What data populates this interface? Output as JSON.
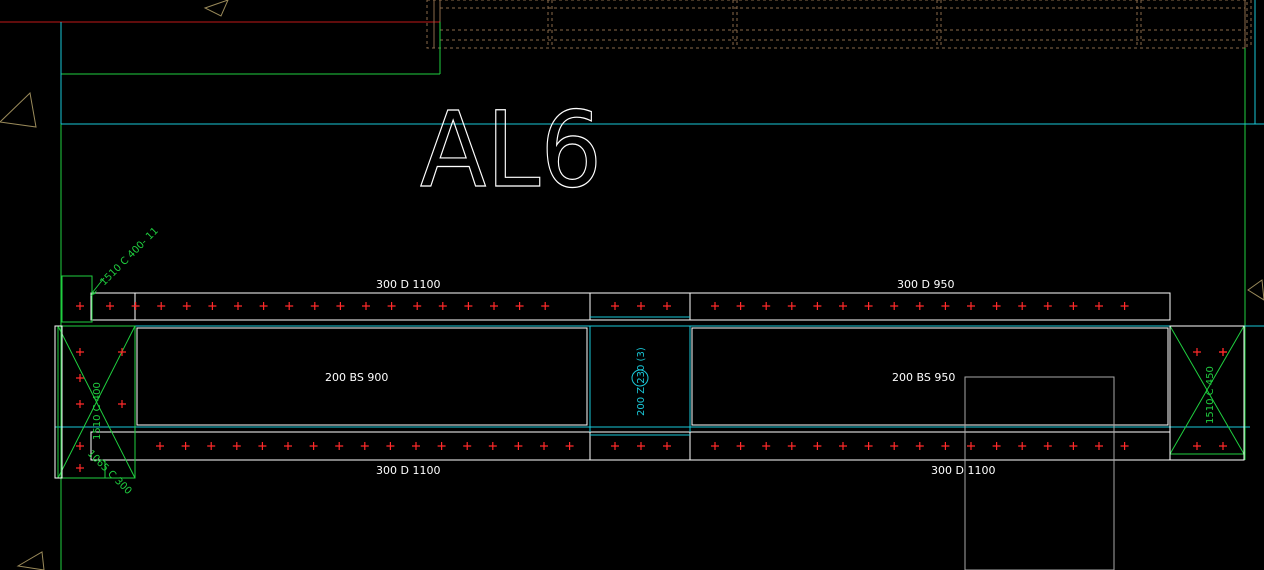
{
  "drawing": {
    "title": "AL6",
    "colors": {
      "background": "#000000",
      "outline": "#ffffff",
      "cyan": "#19c9d9",
      "green": "#1fcf3f",
      "rebar_mark": "#ff2a2a",
      "grid_red": "#c01818",
      "brown": "#8a6a4a",
      "gray": "#a8a8a8"
    },
    "labels": {
      "top_left": "300  D 1100",
      "top_right": "300  D 950",
      "bottom_left": "300  D 1100",
      "bottom_right": "300  D 1100",
      "mid_left": "200  BS 900",
      "mid_right": "200  BS 950",
      "center_vertical": "200  Z 230 (3)",
      "green_top": "1510  C 400- 11",
      "green_left": "1510  C 400",
      "green_bottom": "1065  C 300",
      "green_right": "1510  C 450"
    },
    "icons": [
      "triangle-marker-icon",
      "triangle-marker-icon",
      "triangle-marker-icon",
      "triangle-marker-icon",
      "triangle-marker-icon"
    ]
  }
}
